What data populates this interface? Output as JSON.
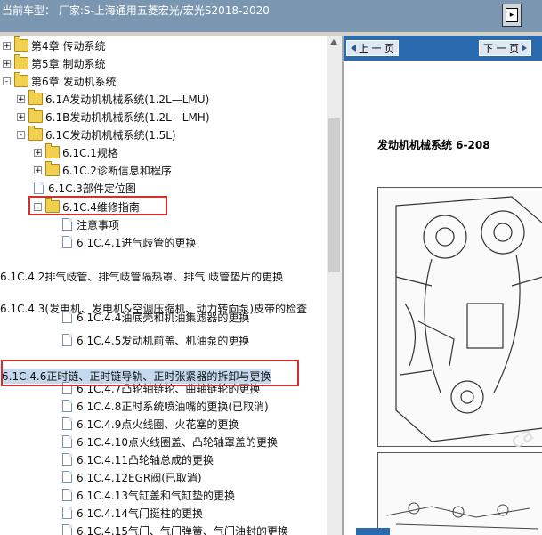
{
  "header": {
    "vehicle_label": "当前车型： 厂家:S-上海通用五菱宏光/宏光S2018-2020",
    "nav_button_glyph": "▸"
  },
  "tree": {
    "rows": [
      {
        "expander": "+",
        "icon": "folder",
        "label": "第4章 传动系统"
      },
      {
        "expander": "+",
        "icon": "folder",
        "label": "第5章 制动系统"
      },
      {
        "expander": "-",
        "icon": "folder-open",
        "label": "第6章 发动机系统"
      },
      {
        "expander": "+",
        "icon": "folder",
        "label": "6.1A发动机机械系统(1.2L—LMU)"
      },
      {
        "expander": "+",
        "icon": "folder",
        "label": "6.1B发动机机械系统(1.2L—LMH)"
      },
      {
        "expander": "-",
        "icon": "folder-open",
        "label": "6.1C发动机机械系统(1.5L)"
      },
      {
        "expander": "+",
        "icon": "folder",
        "label": "6.1C.1规格"
      },
      {
        "expander": "+",
        "icon": "folder",
        "label": "6.1C.2诊断信息和程序"
      },
      {
        "expander": "",
        "icon": "document",
        "label": "6.1C.3部件定位图"
      },
      {
        "expander": "-",
        "icon": "folder-open",
        "label": "6.1C.4维修指南"
      },
      {
        "expander": "",
        "icon": "document",
        "label": "注意事项"
      },
      {
        "expander": "",
        "icon": "document",
        "label": "6.1C.4.1进气歧管的更换"
      },
      {
        "expander": "",
        "icon": "",
        "label": "6.1C.4.2排气歧管、排气歧管隔热罩、排气 歧管垫片的更换"
      },
      {
        "expander": "",
        "icon": "",
        "label": "6.1C.4.3(发电机、发电机&空调压缩机、动力转向泵)皮带的检查"
      },
      {
        "expander": "",
        "icon": "document",
        "label": "6.1C.4.4油底壳和机油集滤器的更换"
      },
      {
        "expander": "",
        "icon": "document",
        "label": "6.1C.4.5发动机前盖、机油泵的更换"
      },
      {
        "expander": "",
        "icon": "",
        "label": "6.1C.4.6正时链、正时链导轨、正时张紧器的拆卸与更换"
      },
      {
        "expander": "",
        "icon": "document",
        "label": "6.1C.4.7凸轮轴链轮、曲轴链轮的更换"
      },
      {
        "expander": "",
        "icon": "document",
        "label": "6.1C.4.8正时系统喷油嘴的更换(已取消)"
      },
      {
        "expander": "",
        "icon": "document",
        "label": "6.1C.4.9点火线圈、火花塞的更换"
      },
      {
        "expander": "",
        "icon": "document",
        "label": "6.1C.4.10点火线圈盖、凸轮轴罩盖的更换"
      },
      {
        "expander": "",
        "icon": "document",
        "label": "6.1C.4.11凸轮轴总成的更换"
      },
      {
        "expander": "",
        "icon": "document",
        "label": "6.1C.4.12EGR阀(已取消)"
      },
      {
        "expander": "",
        "icon": "document",
        "label": "6.1C.4.13气缸盖和气缸垫的更换"
      },
      {
        "expander": "",
        "icon": "document",
        "label": "6.1C.4.14气门挺柱的更换"
      },
      {
        "expander": "",
        "icon": "document",
        "label": "6.1C.4.15气门、气门弹簧、气门油封的更换"
      }
    ]
  },
  "viewer": {
    "prev_label": "上 一 页",
    "next_label": "下 一 页",
    "page_heading": "发动机机械系统 6-208",
    "watermark": "ca"
  }
}
